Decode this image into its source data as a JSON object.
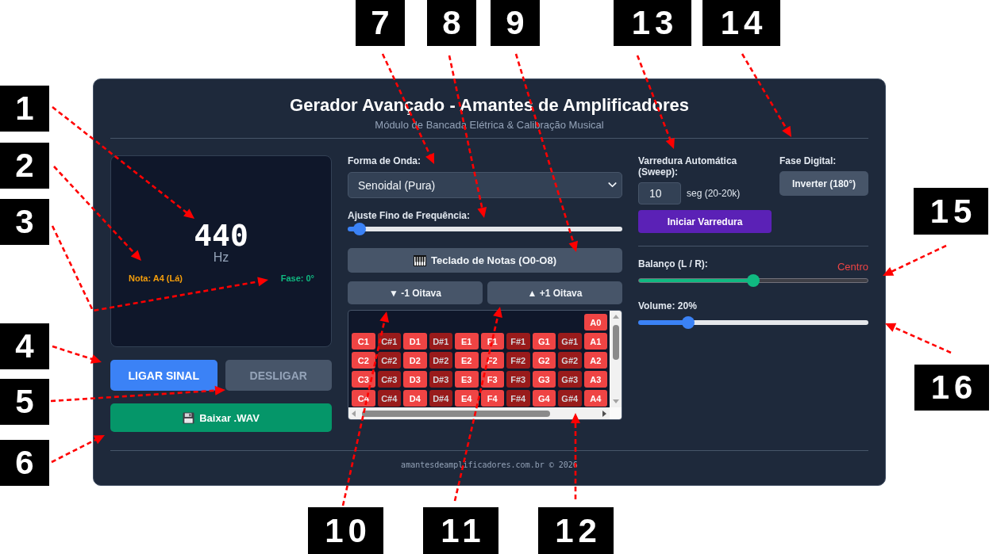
{
  "header": {
    "title": "Gerador Avançado - Amantes de Amplificadores",
    "subtitle": "Módulo de Bancada Elétrica & Calibração Musical"
  },
  "display": {
    "frequency": "440",
    "unit": "Hz",
    "note": "Nota: A4 (Lá)",
    "phase": "Fase: 0°"
  },
  "signal_buttons": [
    {
      "label": "LIGAR SINAL",
      "kind": "start",
      "disabled": false
    },
    {
      "label": "DESLIGAR",
      "kind": "stop",
      "disabled": true
    }
  ],
  "download_button": {
    "label": "Baixar .WAV"
  },
  "waveform": {
    "label": "Forma de Onda:",
    "value": "Senoidal (Pura)"
  },
  "fine_tune": {
    "label": "Ajuste Fino de Frequência:",
    "level": 0.02
  },
  "keyboard_button": {
    "label": "Teclado de Notas (O0-O8)"
  },
  "octave_buttons": [
    {
      "label": "▼ -1 Oitava"
    },
    {
      "label": "▲ +1 Oitava"
    }
  ],
  "keyboard": {
    "rows": [
      {
        "keys": [
          {
            "label": "A0",
            "kind": "natural"
          }
        ]
      },
      {
        "keys": [
          {
            "label": "C1",
            "kind": "natural"
          },
          {
            "label": "C#1",
            "kind": "sharp"
          },
          {
            "label": "D1",
            "kind": "natural"
          },
          {
            "label": "D#1",
            "kind": "sharp"
          },
          {
            "label": "E1",
            "kind": "natural"
          },
          {
            "label": "F1",
            "kind": "natural"
          },
          {
            "label": "F#1",
            "kind": "sharp"
          },
          {
            "label": "G1",
            "kind": "natural"
          },
          {
            "label": "G#1",
            "kind": "sharp"
          },
          {
            "label": "A1",
            "kind": "natural"
          }
        ]
      },
      {
        "keys": [
          {
            "label": "C2",
            "kind": "natural"
          },
          {
            "label": "C#2",
            "kind": "sharp"
          },
          {
            "label": "D2",
            "kind": "natural"
          },
          {
            "label": "D#2",
            "kind": "sharp"
          },
          {
            "label": "E2",
            "kind": "natural"
          },
          {
            "label": "F2",
            "kind": "natural"
          },
          {
            "label": "F#2",
            "kind": "sharp"
          },
          {
            "label": "G2",
            "kind": "natural"
          },
          {
            "label": "G#2",
            "kind": "sharp"
          },
          {
            "label": "A2",
            "kind": "natural"
          }
        ]
      },
      {
        "keys": [
          {
            "label": "C3",
            "kind": "natural"
          },
          {
            "label": "C#3",
            "kind": "sharp"
          },
          {
            "label": "D3",
            "kind": "natural"
          },
          {
            "label": "D#3",
            "kind": "sharp"
          },
          {
            "label": "E3",
            "kind": "natural"
          },
          {
            "label": "F3",
            "kind": "natural"
          },
          {
            "label": "F#3",
            "kind": "sharp"
          },
          {
            "label": "G3",
            "kind": "natural"
          },
          {
            "label": "G#3",
            "kind": "sharp"
          },
          {
            "label": "A3",
            "kind": "natural"
          }
        ]
      },
      {
        "keys": [
          {
            "label": "C4",
            "kind": "natural"
          },
          {
            "label": "C#4",
            "kind": "sharp"
          },
          {
            "label": "D4",
            "kind": "natural"
          },
          {
            "label": "D#4",
            "kind": "sharp"
          },
          {
            "label": "E4",
            "kind": "natural"
          },
          {
            "label": "F4",
            "kind": "natural"
          },
          {
            "label": "F#4",
            "kind": "sharp"
          },
          {
            "label": "G4",
            "kind": "natural"
          },
          {
            "label": "G#4",
            "kind": "sharp"
          },
          {
            "label": "A4",
            "kind": "natural"
          }
        ]
      }
    ]
  },
  "sweep": {
    "label": "Varredura Automática (Sweep):",
    "value": "10",
    "unit": "seg (20-20k)",
    "button": "Iniciar Varredura"
  },
  "phase_control": {
    "label": "Fase Digital:",
    "button": "Inverter (180°)"
  },
  "balance": {
    "label": "Balanço (L / R):",
    "reading": "Centro",
    "level": 0.5
  },
  "volume": {
    "label": "Volume: 20%",
    "level": 0.2
  },
  "footer": {
    "text": "amantesdeamplificadores.com.br © 2026"
  },
  "callouts": [
    {
      "label": "1"
    },
    {
      "label": "2"
    },
    {
      "label": "3"
    },
    {
      "label": "4"
    },
    {
      "label": "5"
    },
    {
      "label": "6"
    },
    {
      "label": "7"
    },
    {
      "label": "8"
    },
    {
      "label": "9"
    },
    {
      "label": "10"
    },
    {
      "label": "11"
    },
    {
      "label": "12"
    },
    {
      "label": "13"
    },
    {
      "label": "14"
    },
    {
      "label": "15"
    },
    {
      "label": "16"
    }
  ]
}
